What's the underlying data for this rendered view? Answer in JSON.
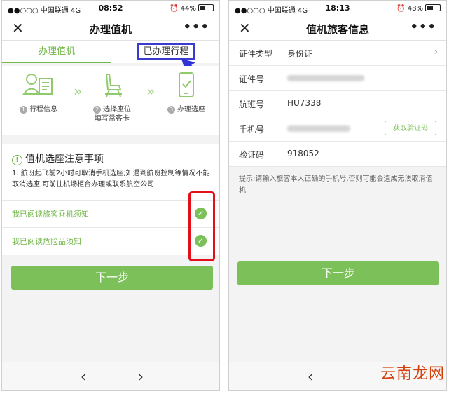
{
  "left": {
    "status": {
      "carrier": "●●○○○ 中国联通  4G",
      "time": "08:52",
      "battery": "44%",
      "battery_fill": 0.44
    },
    "nav": {
      "close": "✕",
      "title": "办理值机",
      "more": "•••"
    },
    "tabs": [
      {
        "label": "办理值机",
        "active": true
      },
      {
        "label": "已办理行程",
        "active": false
      }
    ],
    "steps": [
      {
        "num": "1",
        "label": "行程信息"
      },
      {
        "num": "2",
        "label": "选择座位",
        "label2": "填写常客卡"
      },
      {
        "num": "3",
        "label": "办理选座"
      }
    ],
    "notice": {
      "title": "值机选座注意事项",
      "body": "1. 航班起飞前2小时可取消手机选座;如遇到航班控制等情况不能取消选座,可前往机场柜台办理或联系航空公司"
    },
    "agreements": [
      {
        "label": "我已阅读旅客乘机须知",
        "checked": true
      },
      {
        "label": "我已阅读危险品须知",
        "checked": true
      }
    ],
    "next_label": "下一步",
    "bottom": {
      "back": "‹",
      "forward": "›"
    }
  },
  "right": {
    "status": {
      "carrier": "●●○○○ 中国联通  4G",
      "time": "18:13",
      "battery": "48%",
      "battery_fill": 0.48
    },
    "nav": {
      "close": "✕",
      "title": "值机旅客信息",
      "more": "•••"
    },
    "fields": {
      "id_type": {
        "label": "证件类型",
        "value": "身份证"
      },
      "id_number": {
        "label": "证件号"
      },
      "flight": {
        "label": "航班号",
        "value": "HU7338"
      },
      "phone": {
        "label": "手机号",
        "button": "获取验证码"
      },
      "code": {
        "label": "验证码",
        "value": "918052"
      }
    },
    "tip": "提示:请输入旅客本人正确的手机号,否则可能会造成无法取消值机",
    "next_label": "下一步",
    "bottom": {
      "back": "‹"
    }
  },
  "watermark": "云南龙网",
  "colors": {
    "accent": "#7cc05a",
    "highlight_box": "#e3101c",
    "pointer": "#3b3ccf"
  }
}
